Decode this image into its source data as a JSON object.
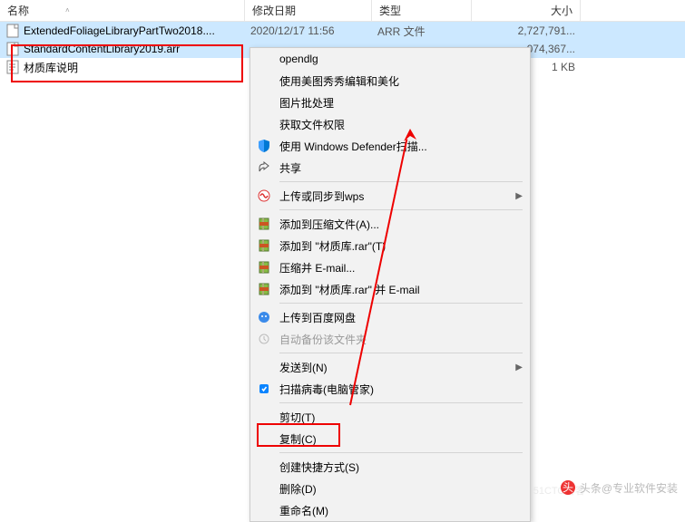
{
  "columns": {
    "name": "名称",
    "date": "修改日期",
    "type": "类型",
    "size": "大小"
  },
  "files": [
    {
      "name": "ExtendedFoliageLibraryPartTwo2018....",
      "date": "2020/12/17 11:56",
      "type": "ARR 文件",
      "size": "2,727,791..."
    },
    {
      "name": "StandardContentLibrary2019.arr",
      "date": "",
      "type": "",
      "size": "074,367..."
    },
    {
      "name": "材质库说明",
      "date": "",
      "type": "",
      "size": "1 KB"
    }
  ],
  "menu": {
    "opendlg": "opendlg",
    "meitu": "使用美图秀秀编辑和美化",
    "batch": "图片批处理",
    "perm": "获取文件权限",
    "defender": "使用 Windows Defender扫描...",
    "share": "共享",
    "wps": "上传或同步到wps",
    "rar1": "添加到压缩文件(A)...",
    "rar2": "添加到 \"材质库.rar\"(T)",
    "rar3": "压缩并 E-mail...",
    "rar4": "添加到 \"材质库.rar\" 并 E-mail",
    "baidu": "上传到百度网盘",
    "backup": "自动备份该文件夹",
    "sendto": "发送到(N)",
    "scan": "扫描病毒(电脑管家)",
    "cut": "剪切(T)",
    "copy": "复制(C)",
    "shortcut": "创建快捷方式(S)",
    "delete": "删除(D)",
    "rename": "重命名(M)"
  },
  "watermark": "头条@专业软件安装",
  "attribution": "51CTO博客"
}
